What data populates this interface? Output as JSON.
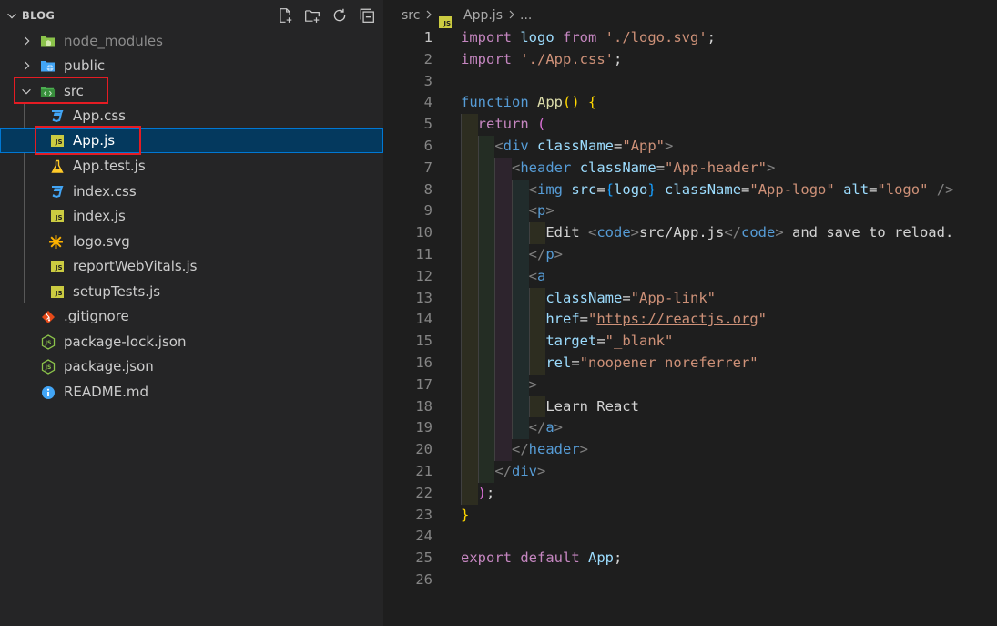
{
  "explorer": {
    "title": "BLOG",
    "actions": [
      "new-file-icon",
      "new-folder-icon",
      "refresh-icon",
      "collapse-all-icon"
    ],
    "items": [
      {
        "label": "node_modules",
        "kind": "folder",
        "icon": "node-folder-icon",
        "depth": 0,
        "expanded": false
      },
      {
        "label": "public",
        "kind": "folder",
        "icon": "public-folder-icon",
        "depth": 0,
        "expanded": false
      },
      {
        "label": "src",
        "kind": "folder",
        "icon": "src-folder-icon",
        "depth": 0,
        "expanded": true
      },
      {
        "label": "App.css",
        "kind": "file",
        "icon": "css-file-icon",
        "depth": 1
      },
      {
        "label": "App.js",
        "kind": "file",
        "icon": "js-file-icon",
        "depth": 1,
        "selected": true
      },
      {
        "label": "App.test.js",
        "kind": "file",
        "icon": "test-file-icon",
        "depth": 1
      },
      {
        "label": "index.css",
        "kind": "file",
        "icon": "css-file-icon",
        "depth": 1
      },
      {
        "label": "index.js",
        "kind": "file",
        "icon": "js-file-icon",
        "depth": 1
      },
      {
        "label": "logo.svg",
        "kind": "file",
        "icon": "svg-file-icon",
        "depth": 1
      },
      {
        "label": "reportWebVitals.js",
        "kind": "file",
        "icon": "js-file-icon",
        "depth": 1
      },
      {
        "label": "setupTests.js",
        "kind": "file",
        "icon": "js-file-icon",
        "depth": 1
      },
      {
        "label": ".gitignore",
        "kind": "file",
        "icon": "git-file-icon",
        "depth": 0
      },
      {
        "label": "package-lock.json",
        "kind": "file",
        "icon": "npm-json-icon",
        "depth": 0
      },
      {
        "label": "package.json",
        "kind": "file",
        "icon": "npm-json-icon",
        "depth": 0
      },
      {
        "label": "README.md",
        "kind": "file",
        "icon": "info-icon",
        "depth": 0
      }
    ]
  },
  "breadcrumb": {
    "folder": "src",
    "file": "App.js",
    "ellipsis": "...",
    "separator": ">"
  },
  "badges": {
    "js": "JS"
  },
  "code": {
    "line_numbers": [
      "1",
      "2",
      "3",
      "4",
      "5",
      "6",
      "7",
      "8",
      "9",
      "10",
      "11",
      "12",
      "13",
      "14",
      "15",
      "16",
      "17",
      "18",
      "19",
      "20",
      "21",
      "22",
      "23",
      "24",
      "25",
      "26"
    ],
    "active_line": "1",
    "lines": [
      [
        {
          "t": "import",
          "c": "kc"
        },
        {
          "t": " logo ",
          "c": "v"
        },
        {
          "t": "from",
          "c": "kc"
        },
        {
          "t": " ",
          "c": ""
        },
        {
          "t": "'./logo.svg'",
          "c": "s"
        },
        {
          "t": ";",
          "c": ""
        }
      ],
      [
        {
          "t": "import",
          "c": "kc"
        },
        {
          "t": " ",
          "c": ""
        },
        {
          "t": "'./App.css'",
          "c": "s"
        },
        {
          "t": ";",
          "c": ""
        }
      ],
      [],
      [
        {
          "t": "function",
          "c": "k"
        },
        {
          "t": " ",
          "c": ""
        },
        {
          "t": "App",
          "c": "f"
        },
        {
          "t": "() ",
          "c": "br1"
        },
        {
          "t": "{",
          "c": "br1"
        }
      ],
      [
        {
          "t": "  ",
          "c": ""
        },
        {
          "t": "return",
          "c": "kc"
        },
        {
          "t": " ",
          "c": ""
        },
        {
          "t": "(",
          "c": "br2"
        }
      ],
      [
        {
          "t": "    ",
          "c": ""
        },
        {
          "t": "<",
          "c": "g"
        },
        {
          "t": "div",
          "c": "t"
        },
        {
          "t": " ",
          "c": ""
        },
        {
          "t": "className",
          "c": "a"
        },
        {
          "t": "=",
          "c": ""
        },
        {
          "t": "\"App\"",
          "c": "s"
        },
        {
          "t": ">",
          "c": "g"
        }
      ],
      [
        {
          "t": "      ",
          "c": ""
        },
        {
          "t": "<",
          "c": "g"
        },
        {
          "t": "header",
          "c": "t"
        },
        {
          "t": " ",
          "c": ""
        },
        {
          "t": "className",
          "c": "a"
        },
        {
          "t": "=",
          "c": ""
        },
        {
          "t": "\"App-header\"",
          "c": "s"
        },
        {
          "t": ">",
          "c": "g"
        }
      ],
      [
        {
          "t": "        ",
          "c": ""
        },
        {
          "t": "<",
          "c": "g"
        },
        {
          "t": "img",
          "c": "t"
        },
        {
          "t": " ",
          "c": ""
        },
        {
          "t": "src",
          "c": "a"
        },
        {
          "t": "=",
          "c": ""
        },
        {
          "t": "{",
          "c": "br3"
        },
        {
          "t": "logo",
          "c": "v"
        },
        {
          "t": "}",
          "c": "br3"
        },
        {
          "t": " ",
          "c": ""
        },
        {
          "t": "className",
          "c": "a"
        },
        {
          "t": "=",
          "c": ""
        },
        {
          "t": "\"App-logo\"",
          "c": "s"
        },
        {
          "t": " ",
          "c": ""
        },
        {
          "t": "alt",
          "c": "a"
        },
        {
          "t": "=",
          "c": ""
        },
        {
          "t": "\"logo\"",
          "c": "s"
        },
        {
          "t": " ",
          "c": ""
        },
        {
          "t": "/>",
          "c": "g"
        }
      ],
      [
        {
          "t": "        ",
          "c": ""
        },
        {
          "t": "<",
          "c": "g"
        },
        {
          "t": "p",
          "c": "t"
        },
        {
          "t": ">",
          "c": "g"
        }
      ],
      [
        {
          "t": "          Edit ",
          "c": ""
        },
        {
          "t": "<",
          "c": "g"
        },
        {
          "t": "code",
          "c": "t"
        },
        {
          "t": ">",
          "c": "g"
        },
        {
          "t": "src/App.js",
          "c": ""
        },
        {
          "t": "</",
          "c": "g"
        },
        {
          "t": "code",
          "c": "t"
        },
        {
          "t": ">",
          "c": "g"
        },
        {
          "t": " and save to reload.",
          "c": ""
        }
      ],
      [
        {
          "t": "        ",
          "c": ""
        },
        {
          "t": "</",
          "c": "g"
        },
        {
          "t": "p",
          "c": "t"
        },
        {
          "t": ">",
          "c": "g"
        }
      ],
      [
        {
          "t": "        ",
          "c": ""
        },
        {
          "t": "<",
          "c": "g"
        },
        {
          "t": "a",
          "c": "t"
        }
      ],
      [
        {
          "t": "          ",
          "c": ""
        },
        {
          "t": "className",
          "c": "a"
        },
        {
          "t": "=",
          "c": ""
        },
        {
          "t": "\"App-link\"",
          "c": "s"
        }
      ],
      [
        {
          "t": "          ",
          "c": ""
        },
        {
          "t": "href",
          "c": "a"
        },
        {
          "t": "=",
          "c": ""
        },
        {
          "t": "\"",
          "c": "s"
        },
        {
          "t": "https://reactjs.org",
          "c": "s u"
        },
        {
          "t": "\"",
          "c": "s"
        }
      ],
      [
        {
          "t": "          ",
          "c": ""
        },
        {
          "t": "target",
          "c": "a"
        },
        {
          "t": "=",
          "c": ""
        },
        {
          "t": "\"_blank\"",
          "c": "s"
        }
      ],
      [
        {
          "t": "          ",
          "c": ""
        },
        {
          "t": "rel",
          "c": "a"
        },
        {
          "t": "=",
          "c": ""
        },
        {
          "t": "\"noopener noreferrer\"",
          "c": "s"
        }
      ],
      [
        {
          "t": "        ",
          "c": ""
        },
        {
          "t": ">",
          "c": "g"
        }
      ],
      [
        {
          "t": "          Learn React",
          "c": ""
        }
      ],
      [
        {
          "t": "        ",
          "c": ""
        },
        {
          "t": "</",
          "c": "g"
        },
        {
          "t": "a",
          "c": "t"
        },
        {
          "t": ">",
          "c": "g"
        }
      ],
      [
        {
          "t": "      ",
          "c": ""
        },
        {
          "t": "</",
          "c": "g"
        },
        {
          "t": "header",
          "c": "t"
        },
        {
          "t": ">",
          "c": "g"
        }
      ],
      [
        {
          "t": "    ",
          "c": ""
        },
        {
          "t": "</",
          "c": "g"
        },
        {
          "t": "div",
          "c": "t"
        },
        {
          "t": ">",
          "c": "g"
        }
      ],
      [
        {
          "t": "  ",
          "c": ""
        },
        {
          "t": ")",
          "c": "br2"
        },
        {
          "t": ";",
          "c": ""
        }
      ],
      [
        {
          "t": "}",
          "c": "br1"
        }
      ],
      [],
      [
        {
          "t": "export",
          "c": "kc"
        },
        {
          "t": " ",
          "c": ""
        },
        {
          "t": "default",
          "c": "kc"
        },
        {
          "t": " ",
          "c": ""
        },
        {
          "t": "App",
          "c": "v"
        },
        {
          "t": ";",
          "c": ""
        }
      ],
      []
    ]
  },
  "colors": {
    "sidebar_bg": "#252526",
    "editor_bg": "#1e1e1e",
    "selection_bg": "#04395e",
    "selection_border": "#0078d4",
    "highlight_box": "#e51c23"
  }
}
